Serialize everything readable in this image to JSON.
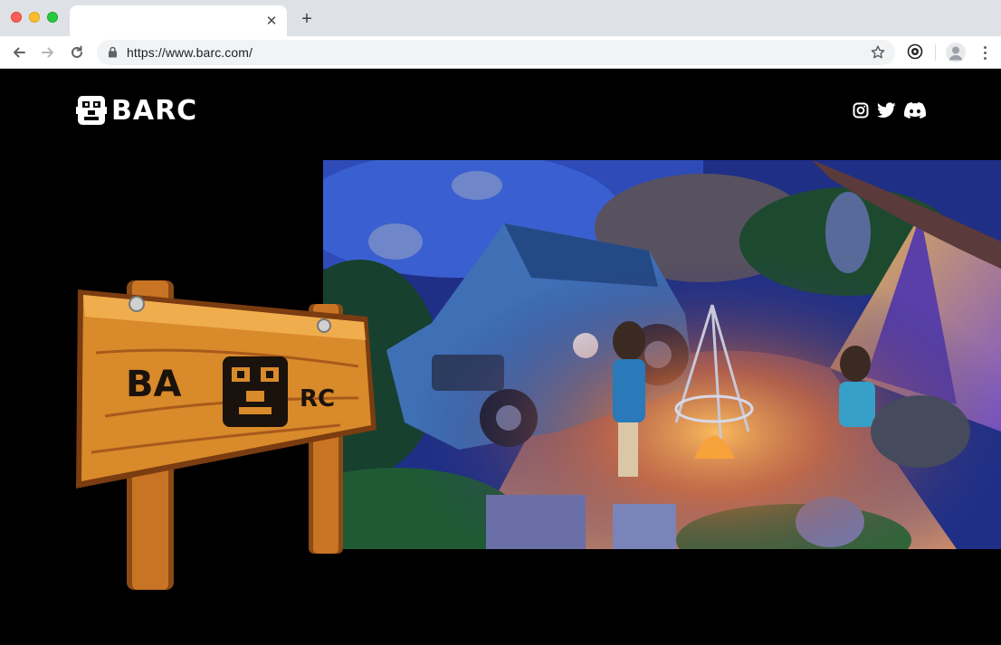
{
  "browser": {
    "tab_title": "",
    "tab_close_icon": "close-icon",
    "new_tab_icon": "plus-icon",
    "url": "https://www.barc.com/",
    "icons": [
      "back-arrow-icon",
      "forward-arrow-icon",
      "reload-icon",
      "lock-icon",
      "star-icon",
      "extension-icon",
      "profile-icon",
      "menu-icon"
    ]
  },
  "site": {
    "logo_text": "BARC",
    "social": [
      "instagram-icon",
      "twitter-icon",
      "discord-icon"
    ],
    "sign": {
      "left_text": "BA",
      "right_text": "RC"
    }
  },
  "colors": {
    "page_bg": "#000000",
    "wood": "#d98a2a",
    "wood_dark": "#8a4a16",
    "hero_night": "#1f2f86",
    "campfire": "#f7a23a"
  }
}
